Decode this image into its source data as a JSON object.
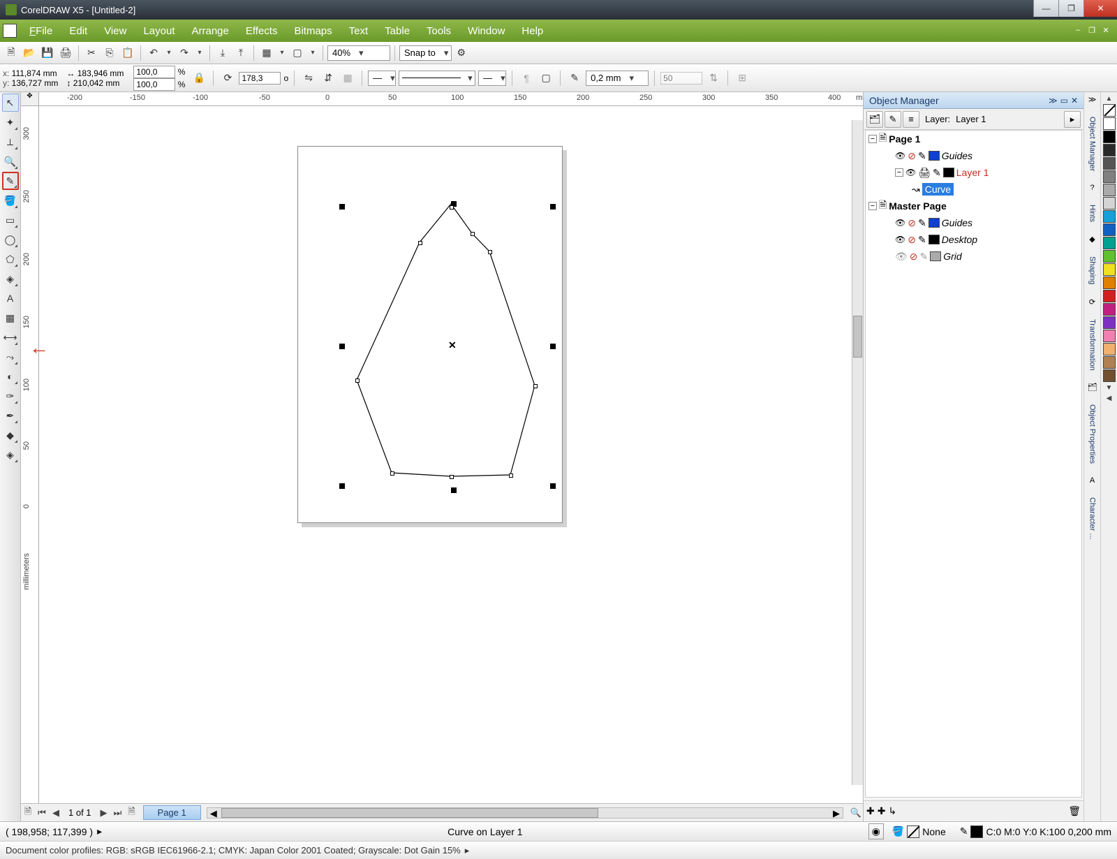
{
  "title": "CorelDRAW X5 - [Untitled-2]",
  "menu": [
    "File",
    "Edit",
    "View",
    "Layout",
    "Arrange",
    "Effects",
    "Bitmaps",
    "Text",
    "Table",
    "Tools",
    "Window",
    "Help"
  ],
  "toolbar": {
    "zoom": "40%",
    "snap": "Snap to"
  },
  "property": {
    "x": "111,874 mm",
    "y": "136,727 mm",
    "w": "183,946 mm",
    "h": "210,042 mm",
    "scale_x": "100,0",
    "scale_y": "100,0",
    "scale_unit": "%",
    "rotation": "178,3",
    "rotation_unit": "o",
    "outline": "0,2 mm",
    "opacity": "50"
  },
  "ruler": {
    "h_ticks": [
      -200,
      -150,
      -100,
      -50,
      0,
      50,
      100,
      150,
      200,
      250,
      300,
      350,
      400
    ],
    "h_unit": "millimeters",
    "v_ticks": [
      300,
      250,
      200,
      150,
      100,
      50,
      0
    ],
    "v_unit": "millimeters"
  },
  "page_nav": {
    "counter": "1 of 1",
    "tab": "Page 1"
  },
  "status": {
    "cursor": "( 198,958; 117,399 )",
    "object": "Curve on Layer 1",
    "fill_none": "None",
    "outline_color": "C:0 M:0 Y:0 K:100  0,200 mm"
  },
  "profiles": "Document color profiles: RGB: sRGB IEC61966-2.1; CMYK: Japan Color 2001 Coated; Grayscale: Dot Gain 15%",
  "docker": {
    "title": "Object Manager",
    "layer_header": "Layer:",
    "layer_current": "Layer 1",
    "tree": {
      "page1": "Page 1",
      "guides1": "Guides",
      "layer1": "Layer 1",
      "curve": "Curve",
      "master": "Master Page",
      "guides2": "Guides",
      "desktop": "Desktop",
      "grid": "Grid"
    },
    "tabs": [
      "Object Manager",
      "Hints",
      "Shaping",
      "Transformation",
      "Object Properties",
      "Character ..."
    ]
  },
  "palette": [
    "#ffffff",
    "#000000",
    "#2a2a2a",
    "#555555",
    "#808080",
    "#aaaaaa",
    "#d4d4d4",
    "#18a0d8",
    "#1060c0",
    "#00a090",
    "#60c030",
    "#f0e020",
    "#e08000",
    "#d02020",
    "#c02080",
    "#8030c0",
    "#f080b0",
    "#f0b070",
    "#b08050",
    "#705030"
  ]
}
